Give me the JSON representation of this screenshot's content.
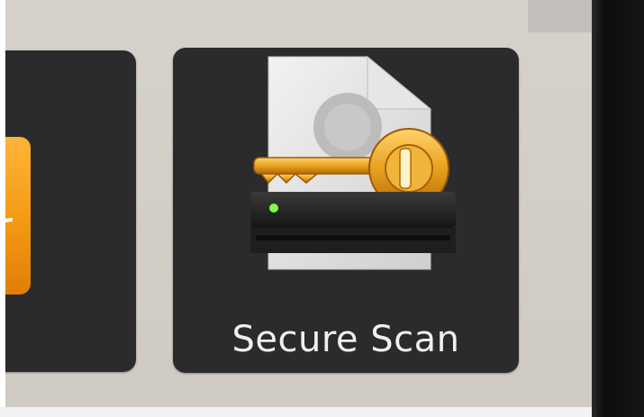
{
  "tiles": [
    {
      "label": "",
      "icon": "document-icon",
      "accent": "#f39a12"
    },
    {
      "label": "Secure Scan",
      "icon": "secure-scan-key-icon",
      "accent": "#e8a21f"
    }
  ],
  "colors": {
    "tile_bg": "#2b2b2d",
    "screen_bg": "#d3cfc8",
    "key_gold": "#e8a21f",
    "led_green": "#7dff45"
  }
}
